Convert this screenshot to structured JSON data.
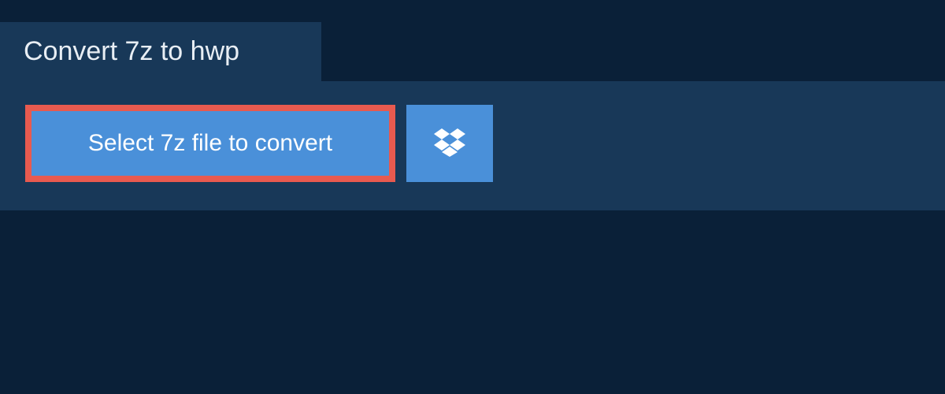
{
  "header": {
    "title": "Convert 7z to hwp"
  },
  "actions": {
    "select_file_label": "Select 7z file to convert"
  },
  "colors": {
    "page_bg": "#0a2038",
    "panel_bg": "#183858",
    "button_bg": "#4a90d9",
    "highlight_border": "#e85a4f",
    "text_light": "#ffffff"
  }
}
